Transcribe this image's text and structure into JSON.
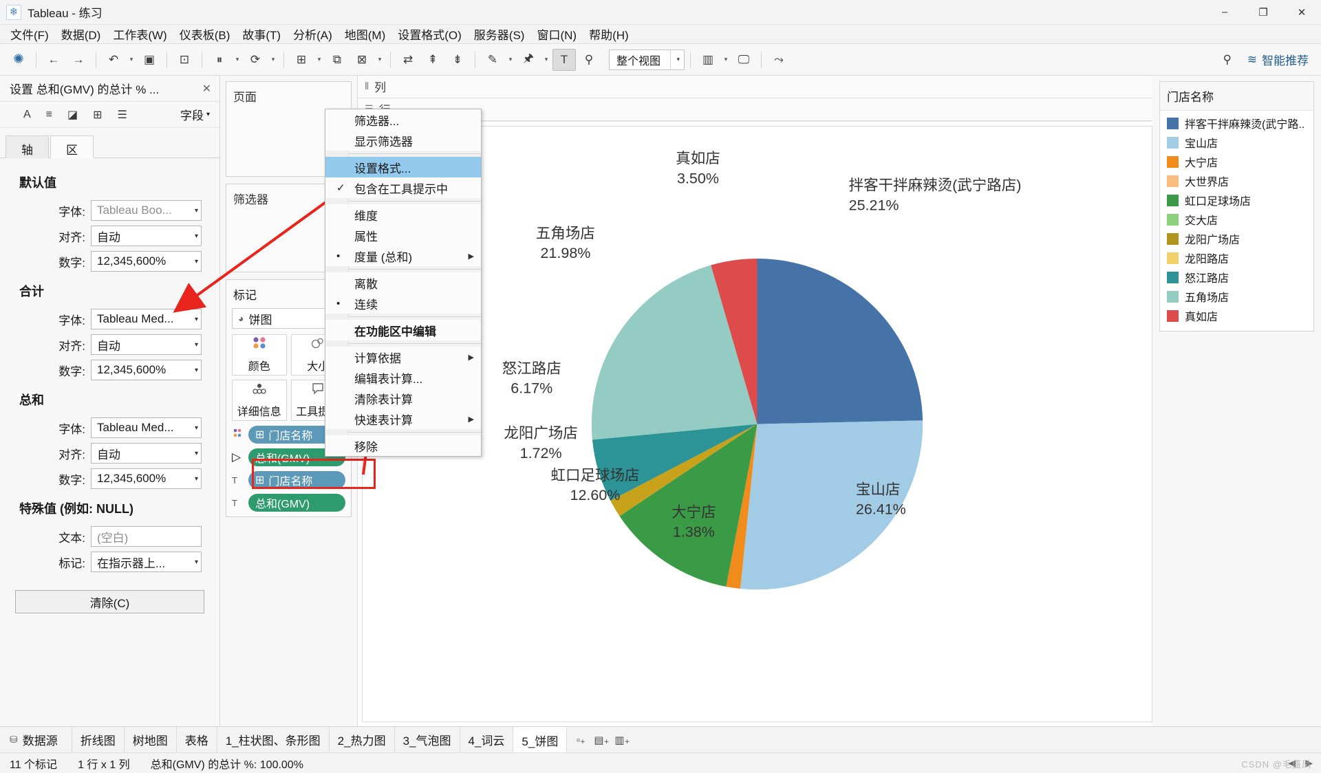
{
  "window": {
    "title": "Tableau - 练习",
    "app_icon": "tableau-logo-icon",
    "minimize": "–",
    "maximize": "❐",
    "close": "✕"
  },
  "menubar": {
    "items": [
      {
        "label": "文件(F)"
      },
      {
        "label": "数据(D)"
      },
      {
        "label": "工作表(W)"
      },
      {
        "label": "仪表板(B)"
      },
      {
        "label": "故事(T)"
      },
      {
        "label": "分析(A)"
      },
      {
        "label": "地图(M)"
      },
      {
        "label": "设置格式(O)"
      },
      {
        "label": "服务器(S)"
      },
      {
        "label": "窗口(N)"
      },
      {
        "label": "帮助(H)"
      }
    ]
  },
  "toolbar": {
    "fit_value": "整个视图",
    "smart_recommend": "智能推荐",
    "icons": [
      "tableau-logo-icon",
      "back-icon",
      "forward-icon",
      "undo-icon",
      "save-icon",
      "new-worksheet-icon",
      "duplicate-icon",
      "clear-icon",
      "refresh-icon",
      "pause-icon",
      "swap-icon",
      "sort-asc-icon",
      "sort-desc-icon",
      "highlight-icon",
      "group-icon",
      "label-icon",
      "fix-axis-icon",
      "presentation-icon",
      "share-icon",
      "pin-icon",
      "recommend-icon"
    ]
  },
  "format_pane": {
    "title": "设置 总和(GMV) 的总计 % ...",
    "close": "✕",
    "toolbar_icons": [
      "font-icon",
      "alignment-icon",
      "shading-icon",
      "borders-icon",
      "lines-icon"
    ],
    "field_selector": "字段",
    "tabs": [
      {
        "label": "轴",
        "active": false
      },
      {
        "label": "区",
        "active": true
      }
    ],
    "sections": [
      {
        "heading": "默认值",
        "rows": [
          {
            "label": "字体:",
            "value": "Tableau Boo...",
            "dim": true
          },
          {
            "label": "对齐:",
            "value": "自动",
            "dim": false
          },
          {
            "label": "数字:",
            "value": "12,345,600%",
            "dim": false
          }
        ]
      },
      {
        "heading": "合计",
        "rows": [
          {
            "label": "字体:",
            "value": "Tableau Med...",
            "dim": false
          },
          {
            "label": "对齐:",
            "value": "自动",
            "dim": false
          },
          {
            "label": "数字:",
            "value": "12,345,600%",
            "dim": false
          }
        ]
      },
      {
        "heading": "总和",
        "rows": [
          {
            "label": "字体:",
            "value": "Tableau Med...",
            "dim": false
          },
          {
            "label": "对齐:",
            "value": "自动",
            "dim": false
          },
          {
            "label": "数字:",
            "value": "12,345,600%",
            "dim": false
          }
        ]
      },
      {
        "heading": "特殊值 (例如: NULL)",
        "rows": [
          {
            "label": "文本:",
            "value": "(空白)",
            "dim": true
          },
          {
            "label": "标记:",
            "value": "在指示器上...",
            "dim": false
          }
        ]
      }
    ],
    "clear_button": "清除(C)"
  },
  "shelves": {
    "pages": {
      "title": "页面"
    },
    "filters": {
      "title": "筛选器"
    },
    "marks": {
      "title": "标记",
      "mark_type": "饼图",
      "mark_type_icon": "pie-icon",
      "buttons": [
        {
          "label": "颜色",
          "icon": "color-icon"
        },
        {
          "label": "大小",
          "icon": "size-icon"
        },
        {
          "label": "详细信息",
          "icon": "detail-icon"
        },
        {
          "label": "工具提示",
          "icon": "tooltip-icon"
        }
      ],
      "pills": [
        {
          "slot_icon": "color-icon",
          "field_icon": "⊞",
          "label": "门店名称",
          "kind": "blue"
        },
        {
          "slot_icon": "angle-icon",
          "field_icon": "",
          "label": "总和(GMV)",
          "kind": "green"
        },
        {
          "slot_icon": "label-icon",
          "field_icon": "⊞",
          "label": "门店名称",
          "kind": "blue"
        },
        {
          "slot_icon": "label-icon",
          "field_icon": "",
          "label": "总和(GMV)",
          "kind": "green"
        }
      ]
    },
    "columns_label": "列",
    "rows_label": "行"
  },
  "context_menu": {
    "items": [
      {
        "label": "筛选器...",
        "mark": "",
        "arrow": false,
        "highlight": false,
        "bold": false,
        "sep_after": false
      },
      {
        "label": "显示筛选器",
        "mark": "",
        "arrow": false,
        "highlight": false,
        "bold": false,
        "sep_after": true
      },
      {
        "label": "设置格式...",
        "mark": "",
        "arrow": false,
        "highlight": true,
        "bold": false,
        "sep_after": false
      },
      {
        "label": "包含在工具提示中",
        "mark": "✓",
        "arrow": false,
        "highlight": false,
        "bold": false,
        "sep_after": true
      },
      {
        "label": "维度",
        "mark": "",
        "arrow": false,
        "highlight": false,
        "bold": false,
        "sep_after": false
      },
      {
        "label": "属性",
        "mark": "",
        "arrow": false,
        "highlight": false,
        "bold": false,
        "sep_after": false
      },
      {
        "label": "度量 (总和)",
        "mark": "•",
        "arrow": true,
        "highlight": false,
        "bold": false,
        "sep_after": true
      },
      {
        "label": "离散",
        "mark": "",
        "arrow": false,
        "highlight": false,
        "bold": false,
        "sep_after": false
      },
      {
        "label": "连续",
        "mark": "•",
        "arrow": false,
        "highlight": false,
        "bold": false,
        "sep_after": true
      },
      {
        "label": "在功能区中编辑",
        "mark": "",
        "arrow": false,
        "highlight": false,
        "bold": true,
        "sep_after": true
      },
      {
        "label": "计算依据",
        "mark": "",
        "arrow": true,
        "highlight": false,
        "bold": false,
        "sep_after": false
      },
      {
        "label": "编辑表计算...",
        "mark": "",
        "arrow": false,
        "highlight": false,
        "bold": false,
        "sep_after": false
      },
      {
        "label": "清除表计算",
        "mark": "",
        "arrow": false,
        "highlight": false,
        "bold": false,
        "sep_after": false
      },
      {
        "label": "快速表计算",
        "mark": "",
        "arrow": true,
        "highlight": false,
        "bold": false,
        "sep_after": true
      },
      {
        "label": "移除",
        "mark": "",
        "arrow": false,
        "highlight": false,
        "bold": false,
        "sep_after": false
      }
    ]
  },
  "legend": {
    "title": "门店名称",
    "items": [
      {
        "label": "拌客干拌麻辣烫(武宁路..",
        "color": "#4572a7"
      },
      {
        "label": "宝山店",
        "color": "#a2cce5"
      },
      {
        "label": "大宁店",
        "color": "#ef8c1c"
      },
      {
        "label": "大世界店",
        "color": "#fbbd7e"
      },
      {
        "label": "虹口足球场店",
        "color": "#3b9a46"
      },
      {
        "label": "交大店",
        "color": "#8bd07a"
      },
      {
        "label": "龙阳广场店",
        "color": "#b0941d"
      },
      {
        "label": "龙阳路店",
        "color": "#f4d06a"
      },
      {
        "label": "怒江路店",
        "color": "#2c9396"
      },
      {
        "label": "五角场店",
        "color": "#94ccc3"
      },
      {
        "label": "真如店",
        "color": "#dd4b4b"
      }
    ]
  },
  "chart_data": {
    "type": "pie",
    "title": "",
    "legend_position": "right",
    "value_format": "percent",
    "categories": [
      "拌客干拌麻辣烫(武宁路店)",
      "宝山店",
      "大宁店",
      "虹口足球场店",
      "龙阳广场店",
      "怒江路店",
      "五角场店",
      "真如店"
    ],
    "labels": [
      {
        "name": "拌客干拌麻辣烫(武宁路店)",
        "value": 25.21,
        "text": "25.21%",
        "color": "#4572a7"
      },
      {
        "name": "宝山店",
        "value": 26.41,
        "text": "26.41%",
        "color": "#a2cce5"
      },
      {
        "name": "大宁店",
        "value": 1.38,
        "text": "1.38%",
        "color": "#ef8c1c"
      },
      {
        "name": "虹口足球场店",
        "value": 12.6,
        "text": "12.60%",
        "color": "#3b9a46"
      },
      {
        "name": "龙阳广场店",
        "value": 1.72,
        "text": "1.72%",
        "color": "#e8c24a"
      },
      {
        "name": "怒江路店",
        "value": 6.17,
        "text": "6.17%",
        "color": "#2c9396"
      },
      {
        "name": "五角场店",
        "value": 21.98,
        "text": "21.98%",
        "color": "#94ccc3"
      },
      {
        "name": "真如店",
        "value": 3.5,
        "text": "3.50%",
        "color": "#dd4b4b"
      }
    ],
    "total": "100.00%"
  },
  "sheet_tabs": {
    "data_source": "数据源",
    "tabs": [
      {
        "label": "折线图",
        "active": false
      },
      {
        "label": "树地图",
        "active": false
      },
      {
        "label": "表格",
        "active": false
      },
      {
        "label": "1_柱状图、条形图",
        "active": false
      },
      {
        "label": "2_热力图",
        "active": false
      },
      {
        "label": "3_气泡图",
        "active": false
      },
      {
        "label": "4_词云",
        "active": false
      },
      {
        "label": "5_饼图",
        "active": true
      }
    ],
    "new_buttons": [
      "new-worksheet-icon",
      "new-dashboard-icon",
      "new-story-icon"
    ]
  },
  "status_bar": {
    "marks": "11 个标记",
    "size": "1 行 x 1 列",
    "aggregate": "总和(GMV) 的总计 %: 100.00%",
    "nav_left": "◀",
    "nav_right": "▶",
    "watermark": "CSDN @毛盛凤"
  }
}
